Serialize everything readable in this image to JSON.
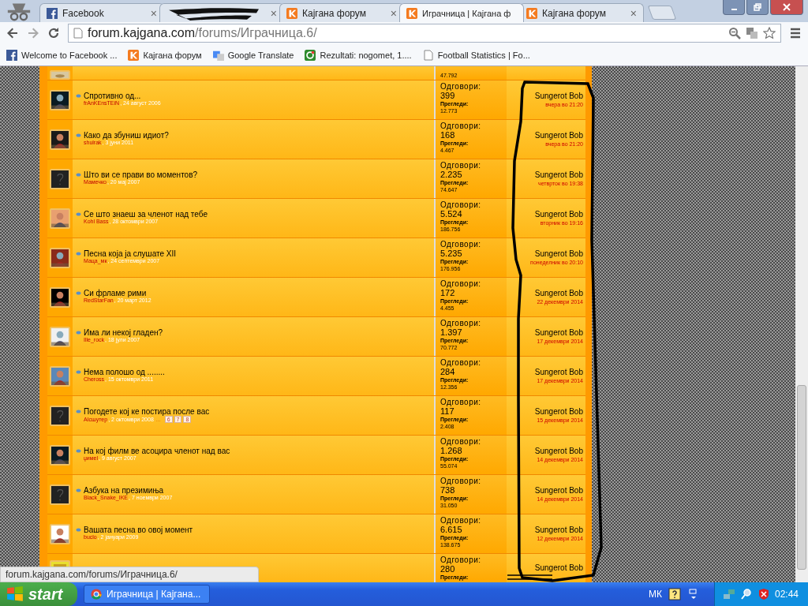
{
  "browser": {
    "tabs": [
      {
        "title": "Facebook",
        "close": "×",
        "selected": false
      },
      {
        "close": "×",
        "selected": false
      },
      {
        "title": "Кајгана форум",
        "close": "×",
        "selected": false
      },
      {
        "title": "Играчница | Кајгана ф",
        "selected": true
      },
      {
        "title": "Кајгана форум",
        "close": "×",
        "selected": false
      }
    ],
    "address": {
      "host": "forum.kajgana.com",
      "path": "/forums/Играчница.6/"
    },
    "bookmarks": [
      {
        "label": "Welcome to Facebook ..."
      },
      {
        "label": "Кајгана форум"
      },
      {
        "label": "Google Translate"
      },
      {
        "label": "Rezultati: nogomet, 1...."
      },
      {
        "label": "Football Statistics | Fo..."
      }
    ]
  },
  "top_partial_row": {
    "views": "47.792"
  },
  "threads": [
    {
      "title": "Спротивно од...",
      "author": "frAnKEnsTEiN",
      "date": ", 24 август 2006",
      "replies_label": "Одговори:",
      "replies": "399",
      "views_label": "Прегледи:",
      "views": "12.773",
      "last_poster": "Sungerot Bob",
      "last_date": "вчера во 21:20"
    },
    {
      "title": "Како да збуниш идиот?",
      "author": "shulrak",
      "date": ", 3 јуни 2011",
      "replies_label": "Одговори:",
      "replies": "168",
      "views_label": "Прегледи:",
      "views": "4.467",
      "last_poster": "Sungerot Bob",
      "last_date": "вчера во 21:20"
    },
    {
      "avatar": {
        "kind": "default"
      },
      "title": "Што ви се прави во моментов?",
      "author": "Мамечко",
      "date": ", 20 мај 2007",
      "replies_label": "Одговори:",
      "replies": "2.235",
      "views_label": "Прегледи:",
      "views": "74.647",
      "last_poster": "Sungerot Bob",
      "last_date": "четврток во 19:38"
    },
    {
      "title": "Се што знаеш за членот над тебе",
      "author": "Kohl Bass",
      "date": ", 28 октомври 2007",
      "replies_label": "Одговори:",
      "replies": "5.524",
      "views_label": "Прегледи:",
      "views": "186.756",
      "last_poster": "Sungerot Bob",
      "last_date": "вторник во 19:16"
    },
    {
      "title": "Песна која ја слушате XII",
      "author": "Маца_мк",
      "date": ", 24 септември 2007",
      "replies_label": "Одговори:",
      "replies": "5.235",
      "views_label": "Прегледи:",
      "views": "176.956",
      "last_poster": "Sungerot Bob",
      "last_date": "понеделник во 20:10"
    },
    {
      "title": "Си фрламе рими",
      "author": "RedStarFan",
      "date": ", 20 март 2012",
      "replies_label": "Одговори:",
      "replies": "172",
      "views_label": "Прегледи:",
      "views": "4.455",
      "last_poster": "Sungerot Bob",
      "last_date": "22 декември 2014"
    },
    {
      "title": "Има ли некој гладен?",
      "author": "Ille_rock",
      "date": ", 18 јули 2007",
      "replies_label": "Одговори:",
      "replies": "1.397",
      "views_label": "Прегледи:",
      "views": "70.772",
      "last_poster": "Sungerot Bob",
      "last_date": "17 декември 2014"
    },
    {
      "title": "Нема полошо од ........",
      "author": "Cheross",
      "date": ", 15 октомври 2011",
      "replies_label": "Одговори:",
      "replies": "284",
      "views_label": "Прегледи:",
      "views": "12.356",
      "last_poster": "Sungerot Bob",
      "last_date": "17 декември 2014"
    },
    {
      "avatar": {
        "kind": "default"
      },
      "title": "Погодете кој ке постира после вас",
      "author": "AIсшутер",
      "date": ", 2 октомври 2008",
      "page_gap": "...",
      "pages": [
        "6",
        "7",
        "8"
      ],
      "replies_label": "Одговори:",
      "replies": "117",
      "views_label": "Прегледи:",
      "views": "2.408",
      "last_poster": "Sungerot Bob",
      "last_date": "15 декември 2014"
    },
    {
      "title": "На кој филм ве асоцира членот над вас",
      "author": "џимеl",
      "date": ", 9 август 2007",
      "replies_label": "Одговори:",
      "replies": "1.268",
      "views_label": "Прегледи:",
      "views": "55.074",
      "last_poster": "Sungerot Bob",
      "last_date": "14 декември 2014"
    },
    {
      "avatar": {
        "kind": "default"
      },
      "title": "Азбука на презимиња",
      "author": "Black_Snake_IKE",
      "date": ", 7 ноември 2007",
      "replies_label": "Одговори:",
      "replies": "738",
      "views_label": "Прегледи:",
      "views": "31.050",
      "last_poster": "Sungerot Bob",
      "last_date": "14 декември 2014"
    },
    {
      "title": "Вашата песна во овој момент",
      "author": "buclo",
      "date": ", 2 јануари 2009",
      "replies_label": "Одговори:",
      "replies": "6.615",
      "views_label": "Прегледи:",
      "views": "138.675",
      "last_poster": "Sungerot Bob",
      "last_date": "12 декември 2014"
    }
  ],
  "bottom_partial_row": {
    "replies_label": "Одговори:",
    "replies": "280",
    "views_label": "Прегледи:",
    "last_poster": "Sungerot Bob"
  },
  "status_url": "forum.kajgana.com/forums/Играчница.6/",
  "taskbar": {
    "start": "start",
    "task": "Играчница | Кајгана...",
    "language": "МК",
    "clock": "02:44"
  }
}
